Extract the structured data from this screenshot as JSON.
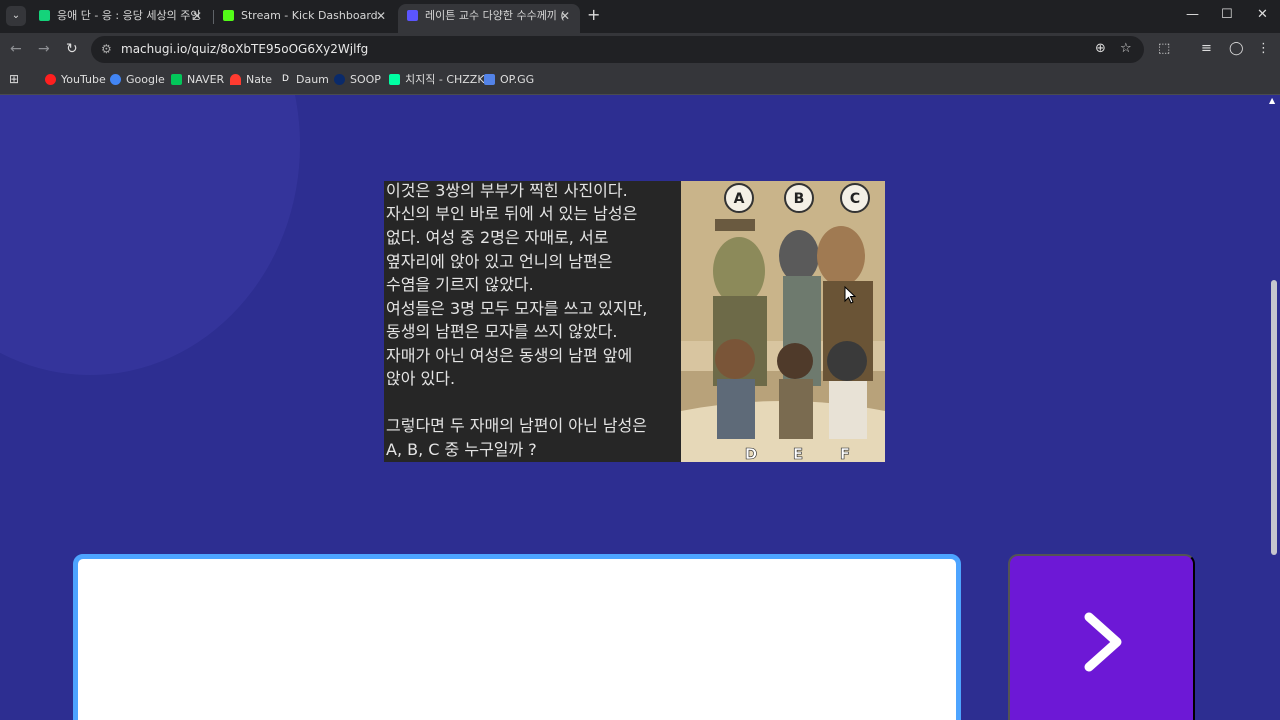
{
  "tabs": [
    {
      "title": "응애 단 - 응 : 응당 세상의 주인",
      "favicon_color": "#14d37a"
    },
    {
      "title": "Stream - Kick Dashboard",
      "favicon_color": "#53fc18"
    },
    {
      "title": "레이튼 교수 다양한 수수께끼 (",
      "favicon_color": "#5b55ff"
    }
  ],
  "address": {
    "url": "machugi.io/quiz/8oXbTE95oOG6Xy2Wjlfg"
  },
  "bookmarks": [
    {
      "label": "YouTube",
      "color": "#ff1f1f"
    },
    {
      "label": "Google",
      "color": "#4285f4"
    },
    {
      "label": "NAVER",
      "color": "#03c75a"
    },
    {
      "label": "Nate",
      "color": "#ff3b30"
    },
    {
      "label": "Daum",
      "color": "#222222"
    },
    {
      "label": "SOOP",
      "color": "#0a2a6a"
    },
    {
      "label": "치지직 - CHZZK",
      "color": "#00ffa3"
    },
    {
      "label": "OP.GG",
      "color": "#5383e8"
    }
  ],
  "quiz": {
    "lines": [
      "이것은 3쌍의 부부가 찍힌 사진이다.",
      "자신의 부인 바로 뒤에 서 있는 남성은",
      "없다. 여성 중 2명은 자매로, 서로",
      "옆자리에 앉아 있고 언니의 남편은",
      "수염을 기르지 않았다.",
      "여성들은 3명 모두 모자를 쓰고 있지만,",
      "동생의 남편은 모자를 쓰지 않았다.",
      "자매가 아닌 여성은 동생의 남편 앞에",
      "앉아 있다.",
      "",
      "그렇다면 두 자매의 남편이 아닌 남성은",
      "A, B, C 중 누구일까 ?"
    ],
    "image_labels": [
      "A",
      "B",
      "C",
      "D",
      "E",
      "F"
    ]
  },
  "colors": {
    "page_bg": "#2d2e91",
    "next_button": "#6d18d6",
    "answer_border": "#4da4ff"
  }
}
